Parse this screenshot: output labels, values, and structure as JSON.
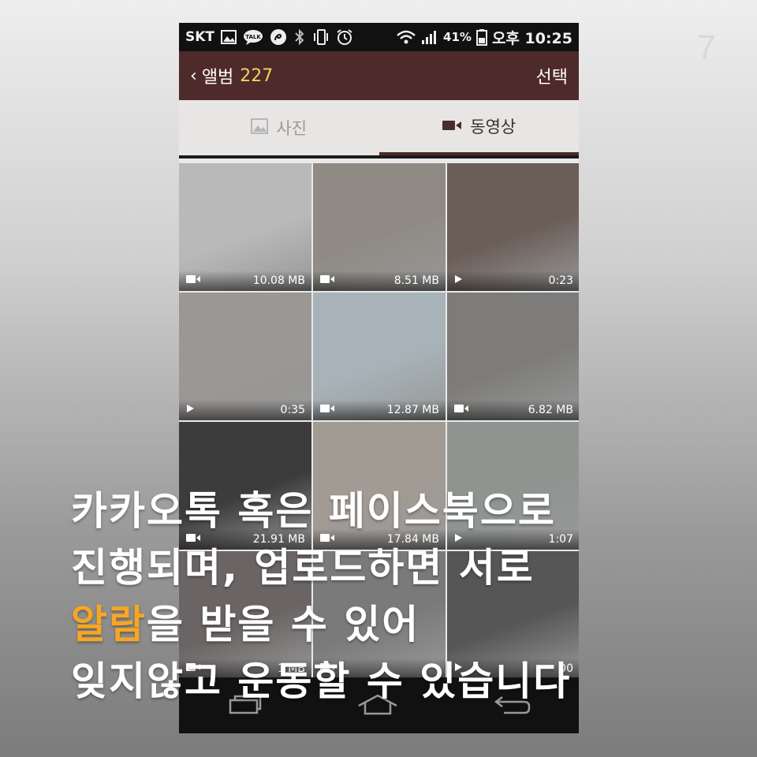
{
  "page_number": "7",
  "status_bar": {
    "carrier": "SKT",
    "battery_percent": "41%",
    "time": "오후 10:25",
    "icons": [
      "gallery-icon",
      "talk-icon",
      "swirl-icon",
      "bluetooth-icon",
      "vibrate-icon",
      "alarm-icon",
      "wifi-icon",
      "signal-icon",
      "battery-icon"
    ]
  },
  "appbar": {
    "back_label": "‹",
    "title": "앨범",
    "count": "227",
    "select_label": "선택"
  },
  "tabs": [
    {
      "label": "사진",
      "icon": "photo-icon",
      "active": false
    },
    {
      "label": "동영상",
      "icon": "video-camera-icon",
      "active": true
    }
  ],
  "tiles": [
    {
      "kind": "video",
      "label": "10.08 MB",
      "bg": "#b9b9b9"
    },
    {
      "kind": "video",
      "label": "8.51 MB",
      "bg": "#8f8b84"
    },
    {
      "kind": "play",
      "label": "0:23",
      "bg": "#6b5e58"
    },
    {
      "kind": "play",
      "label": "0:35",
      "bg": "#9a9794"
    },
    {
      "kind": "video",
      "label": "12.87 MB",
      "bg": "#a7b3b8"
    },
    {
      "kind": "video",
      "label": "6.82 MB",
      "bg": "#7d7c7a"
    },
    {
      "kind": "video",
      "label": "21.91 MB",
      "bg": "#3c3c3c"
    },
    {
      "kind": "video",
      "label": "17.84 MB",
      "bg": "#a29b94"
    },
    {
      "kind": "play",
      "label": "1:07",
      "bg": "#8f9491"
    },
    {
      "kind": "video",
      "label": "1 MB",
      "bg": "#6a6464"
    },
    {
      "kind": "video",
      "label": "",
      "bg": "#7a7a7a"
    },
    {
      "kind": "play",
      "label": "00",
      "bg": "#565656"
    }
  ],
  "overlay_text": {
    "line1": "카카오톡 혹은 페이스북으로",
    "line2": "진행되며, 업로드하면 서로",
    "line3_highlight": "알람",
    "line3_rest": "을 받을 수 있어",
    "line4": "잊지않고 운동할 수 있습니다",
    "highlight_color": "#f7a623"
  },
  "navbar": {
    "icons": [
      "recent-apps-icon",
      "home-icon",
      "back-icon"
    ]
  }
}
